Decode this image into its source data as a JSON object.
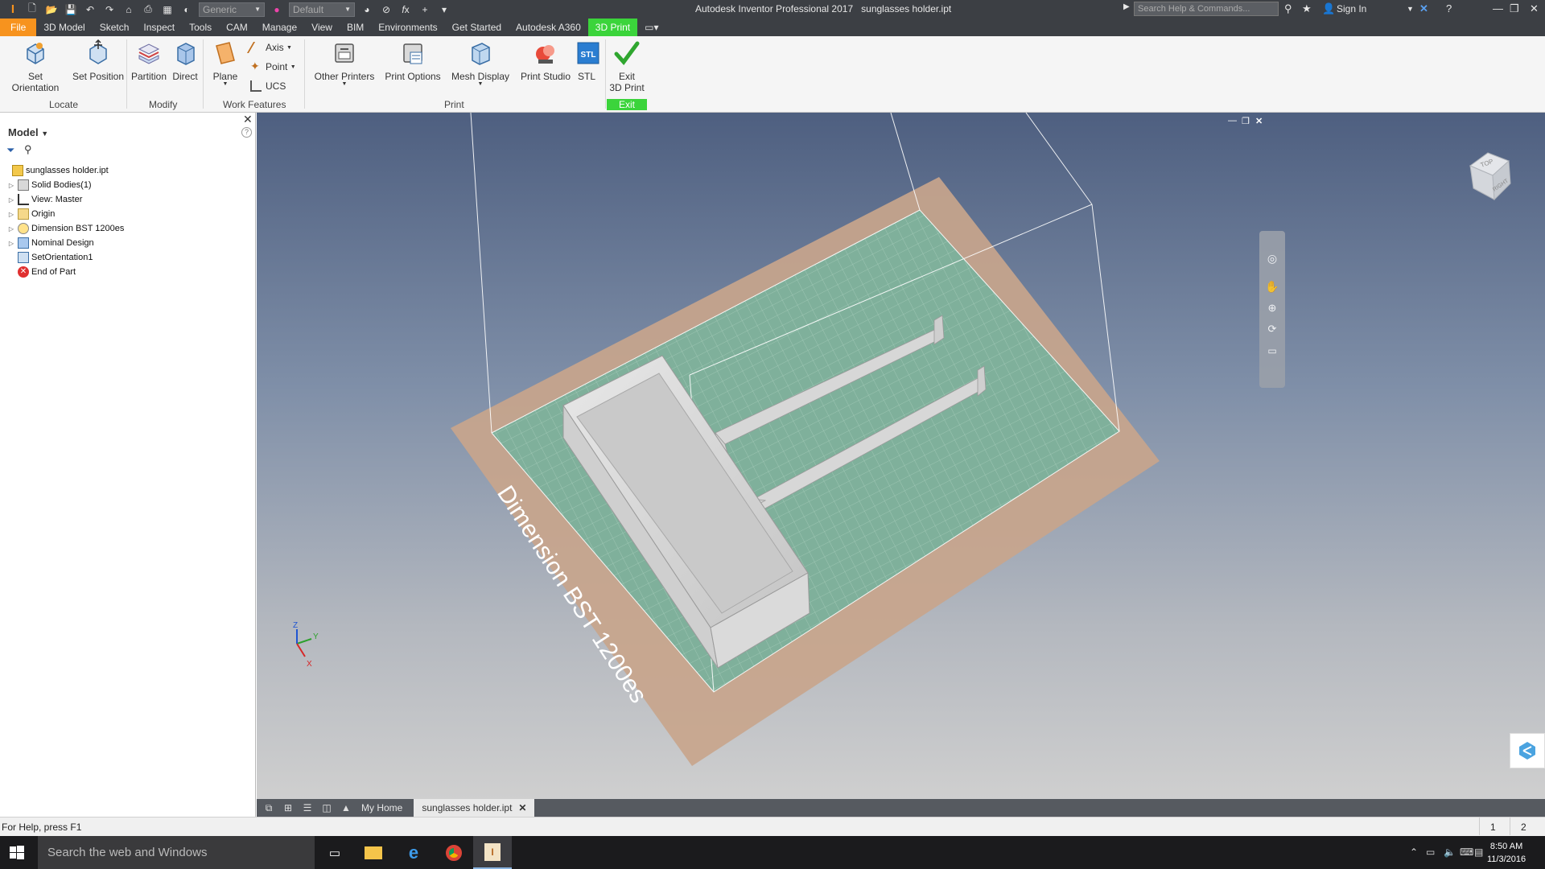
{
  "app": {
    "title": "Autodesk Inventor Professional 2017",
    "document": "sunglasses holder.ipt"
  },
  "quick_access": {
    "material": "Generic",
    "appearance": "Default"
  },
  "search": {
    "placeholder": "Search Help & Commands..."
  },
  "account": {
    "sign_in": "Sign In"
  },
  "menu_tabs": [
    "File",
    "3D Model",
    "Sketch",
    "Inspect",
    "Tools",
    "CAM",
    "Manage",
    "View",
    "BIM",
    "Environments",
    "Get Started",
    "Autodesk A360",
    "3D Print"
  ],
  "active_tab": "3D Print",
  "ribbon": {
    "locate": {
      "label": "Locate",
      "set_orientation": "Set Orientation",
      "set_position": "Set Position"
    },
    "modify": {
      "label": "Modify",
      "partition": "Partition",
      "direct": "Direct"
    },
    "work_features": {
      "label": "Work Features",
      "plane": "Plane",
      "axis": "Axis",
      "point": "Point",
      "ucs": "UCS"
    },
    "print": {
      "label": "Print",
      "other_printers": "Other Printers",
      "print_options": "Print Options",
      "mesh_display": "Mesh Display",
      "print_studio": "Print Studio",
      "stl": "STL"
    },
    "exit": {
      "label": "Exit",
      "exit_line1": "Exit",
      "exit_line2": "3D Print"
    }
  },
  "browser": {
    "title": "Model",
    "tree": [
      {
        "label": "sunglasses holder.ipt",
        "icon": "part-icon",
        "expandable": false,
        "root": true
      },
      {
        "label": "Solid Bodies(1)",
        "icon": "solid-bodies-icon",
        "expandable": true
      },
      {
        "label": "View: Master",
        "icon": "view-icon",
        "expandable": true
      },
      {
        "label": "Origin",
        "icon": "folder-icon",
        "expandable": true
      },
      {
        "label": "Dimension BST 1200es",
        "icon": "printer-icon",
        "expandable": true
      },
      {
        "label": "Nominal Design",
        "icon": "design-icon",
        "expandable": true
      },
      {
        "label": "SetOrientation1",
        "icon": "orientation-icon",
        "expandable": false
      },
      {
        "label": "End of Part",
        "icon": "end-of-part-icon",
        "expandable": false
      }
    ]
  },
  "viewport": {
    "build_plate_label": "Dimension BST 1200es",
    "viewcube_top": "TOP",
    "viewcube_right": "RIGHT",
    "axis_x": "X",
    "axis_y": "Y",
    "axis_z": "Z"
  },
  "doc_tabs": {
    "home": "My Home",
    "current": "sunglasses holder.ipt"
  },
  "status": {
    "help": "For Help, press F1",
    "count1": "1",
    "count2": "2"
  },
  "taskbar": {
    "search_placeholder": "Search the web and Windows",
    "time": "8:50 AM",
    "date": "11/3/2016"
  },
  "colors": {
    "file_tab": "#f7931e",
    "active_tab": "#3bd43b",
    "plate": "#c8a58c",
    "grid": "#7fb09b"
  }
}
